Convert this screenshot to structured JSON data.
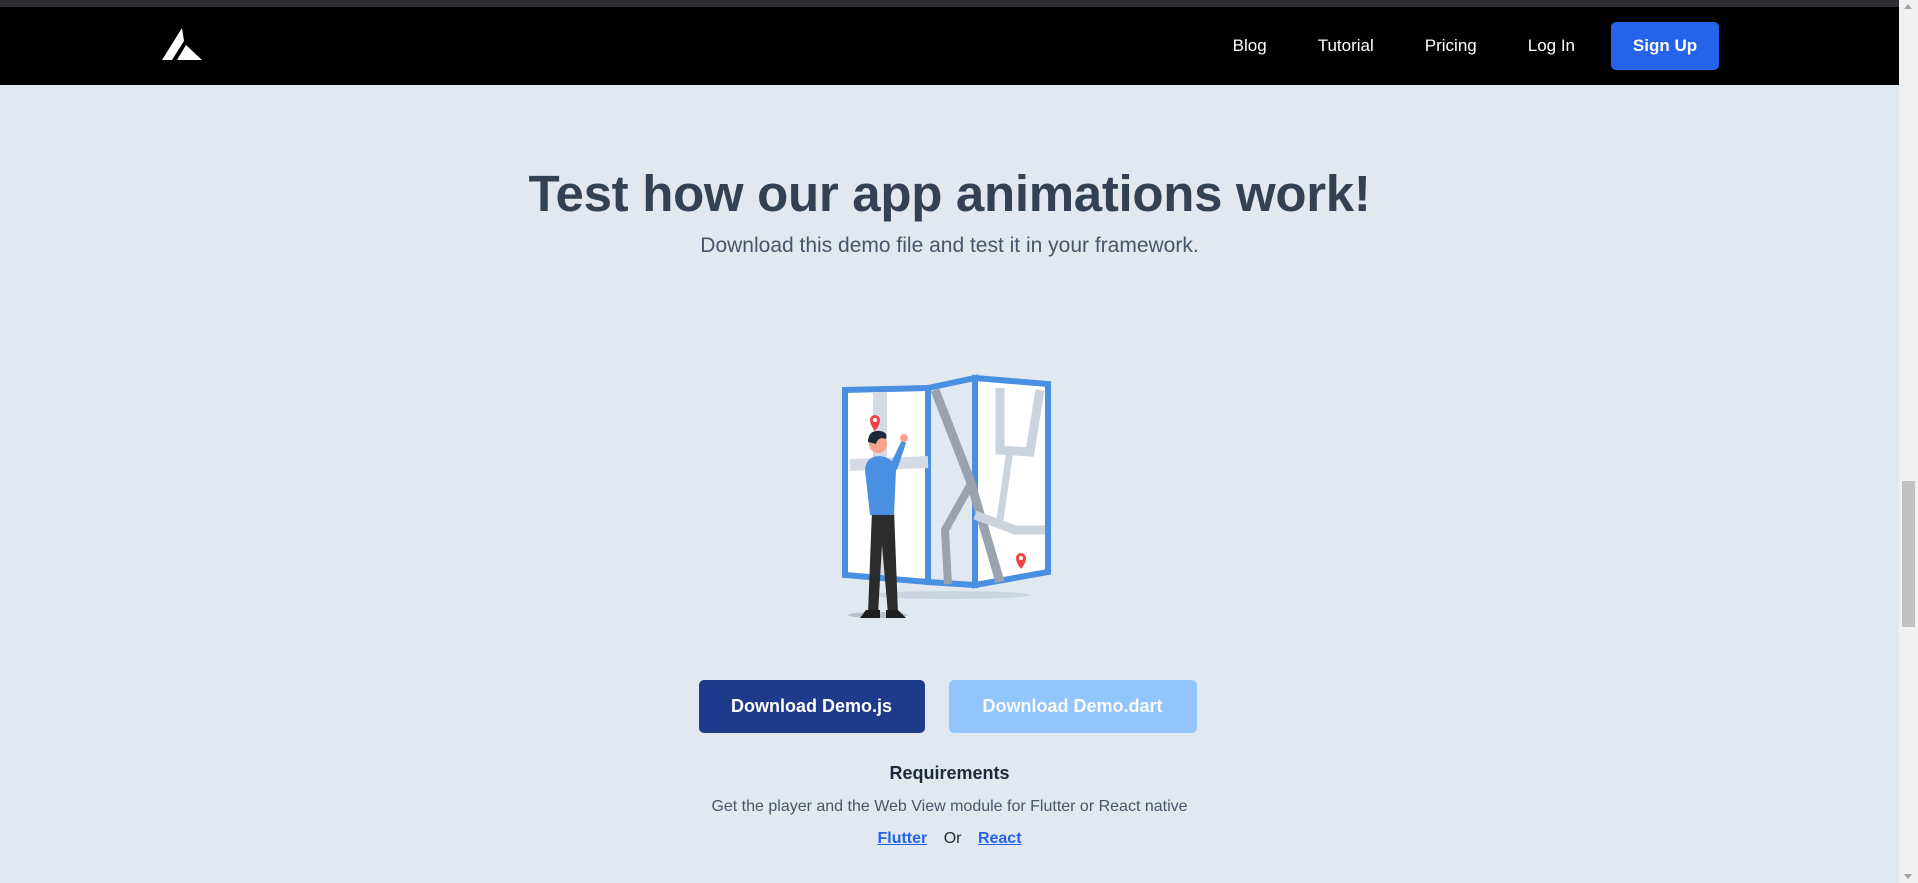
{
  "nav": {
    "logo_icon": "brand-logo-triangle",
    "links": [
      "Blog",
      "Tutorial",
      "Pricing",
      "Log In"
    ],
    "signup_label": "Sign Up"
  },
  "hero": {
    "title": "Test how our app animations work!",
    "subtitle": "Download this demo file and test it in your framework."
  },
  "illustration": {
    "icon": "man-reading-map-illustration"
  },
  "downloads": {
    "primary_label": "Download Demo.js",
    "secondary_label": "Download Demo.dart"
  },
  "requirements": {
    "title": "Requirements",
    "text": "Get the player and the Web View module for Flutter or React native",
    "link_flutter": "Flutter",
    "or_text": "Or",
    "link_react": "React"
  },
  "colors": {
    "page_bg": "#e2e8f0",
    "navbar_bg": "#000000",
    "accent": "#2563eb",
    "primary_button": "#1e3a8a",
    "secondary_button": "#93c5fd",
    "heading": "#334155"
  }
}
